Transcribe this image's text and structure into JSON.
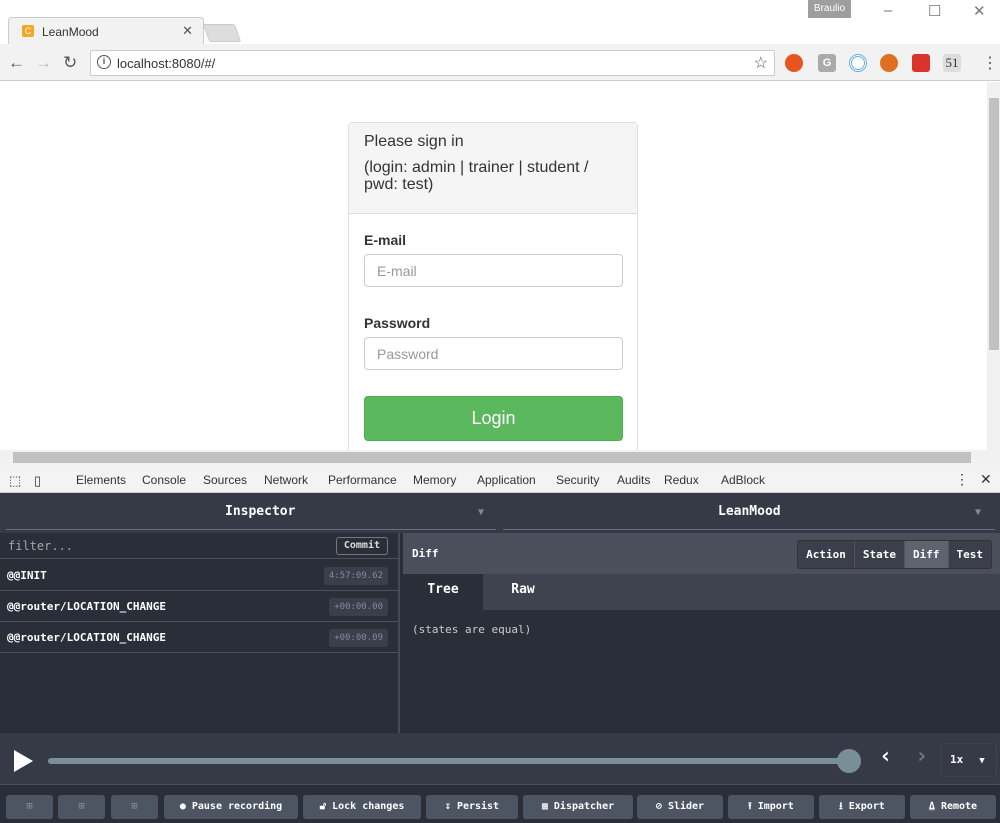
{
  "browser": {
    "tab_title": "LeanMood",
    "user": "Braulio",
    "url": "localhost:8080/#/",
    "extensions": [
      "G",
      "51"
    ]
  },
  "login": {
    "heading": "Please sign in",
    "hint": "(login: admin | trainer | student / pwd: test)",
    "email_label": "E-mail",
    "email_placeholder": "E-mail",
    "password_label": "Password",
    "password_placeholder": "Password",
    "button": "Login"
  },
  "devtools": {
    "tabs": [
      "Elements",
      "Console",
      "Sources",
      "Network",
      "Performance",
      "Memory",
      "Application",
      "Security",
      "Audits",
      "Redux",
      "AdBlock"
    ],
    "active_tab": "Redux"
  },
  "redux": {
    "monitor": "Inspector",
    "store": "LeanMood",
    "filter_placeholder": "filter...",
    "commit": "Commit",
    "actions": [
      {
        "name": "@@INIT",
        "time": "4:57:09.62"
      },
      {
        "name": "@@router/LOCATION_CHANGE",
        "time": "+00:00.00"
      },
      {
        "name": "@@router/LOCATION_CHANGE",
        "time": "+00:00.09"
      }
    ],
    "panel_title": "Diff",
    "segments": [
      "Action",
      "State",
      "Diff",
      "Test"
    ],
    "active_segment": "Diff",
    "subtabs": [
      "Tree",
      "Raw"
    ],
    "active_subtab": "Tree",
    "diff_text": "(states are equal)",
    "slider_position": 1.0,
    "speed": "1x",
    "buttons": [
      "Pause recording",
      "Lock changes",
      "Persist",
      "Dispatcher",
      "Slider",
      "Import",
      "Export",
      "Remote"
    ]
  },
  "colors": {
    "login_button": "#5cb85c",
    "redux_bg": "#2a2e38"
  }
}
